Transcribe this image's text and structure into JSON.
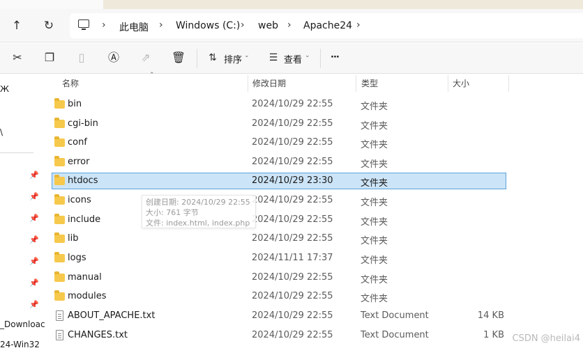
{
  "address": {
    "crumbs": [
      "此电脑",
      "Windows (C:)",
      "web",
      "Apache24"
    ]
  },
  "toolbar": {
    "sort_label": "排序",
    "view_label": "查看",
    "more_label": "···"
  },
  "navpane": {
    "items": [
      "Ж",
      "\\",
      "_Downloac",
      "24-Win32"
    ]
  },
  "columns": {
    "name": "名称",
    "date": "修改日期",
    "type": "类型",
    "size": "大小"
  },
  "files": [
    {
      "name": "bin",
      "date": "2024/10/29 22:55",
      "type": "文件夹",
      "size": "",
      "kind": "folder"
    },
    {
      "name": "cgi-bin",
      "date": "2024/10/29 22:55",
      "type": "文件夹",
      "size": "",
      "kind": "folder"
    },
    {
      "name": "conf",
      "date": "2024/10/29 22:55",
      "type": "文件夹",
      "size": "",
      "kind": "folder"
    },
    {
      "name": "error",
      "date": "2024/10/29 22:55",
      "type": "文件夹",
      "size": "",
      "kind": "folder"
    },
    {
      "name": "htdocs",
      "date": "2024/10/29 23:30",
      "type": "文件夹",
      "size": "",
      "kind": "folder"
    },
    {
      "name": "icons",
      "date": "2024/10/29 22:55",
      "type": "文件夹",
      "size": "",
      "kind": "folder"
    },
    {
      "name": "include",
      "date": "2024/10/29 22:55",
      "type": "文件夹",
      "size": "",
      "kind": "folder"
    },
    {
      "name": "lib",
      "date": "2024/10/29 22:55",
      "type": "文件夹",
      "size": "",
      "kind": "folder"
    },
    {
      "name": "logs",
      "date": "2024/11/11 17:37",
      "type": "文件夹",
      "size": "",
      "kind": "folder"
    },
    {
      "name": "manual",
      "date": "2024/10/29 22:55",
      "type": "文件夹",
      "size": "",
      "kind": "folder"
    },
    {
      "name": "modules",
      "date": "2024/10/29 22:55",
      "type": "文件夹",
      "size": "",
      "kind": "folder"
    },
    {
      "name": "ABOUT_APACHE.txt",
      "date": "2024/10/29 22:55",
      "type": "Text Document",
      "size": "14 KB",
      "kind": "file"
    },
    {
      "name": "CHANGES.txt",
      "date": "2024/10/29 22:55",
      "type": "Text Document",
      "size": "1 KB",
      "kind": "file"
    }
  ],
  "tooltip": {
    "line1": "创建日期: 2024/10/29 22:55",
    "line2": "大小: 761 字节",
    "line3": "文件: index.html, index.php"
  },
  "watermark": "CSDN @heilai4"
}
